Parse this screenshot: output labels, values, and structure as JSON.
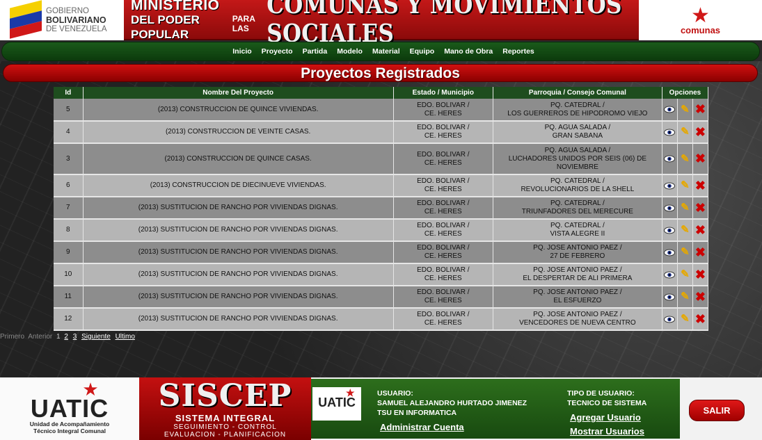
{
  "header": {
    "gov_line1": "GOBIERNO",
    "gov_line2": "BOLIVARIANO",
    "gov_line3": "DE VENEZUELA",
    "ministry_line1": "MINISTERIO",
    "ministry_line2": "DEL PODER POPULAR",
    "ministry_para": "PARA LAS",
    "ministry_big": "COMUNAS Y MOVIMIENTOS SOCIALES",
    "comunas_logo": "comunas"
  },
  "nav": {
    "items": [
      "Inicio",
      "Proyecto",
      "Partida",
      "Modelo",
      "Material",
      "Equipo",
      "Mano de Obra",
      "Reportes"
    ]
  },
  "page_title": "Proyectos Registrados",
  "table": {
    "headers": [
      "Id",
      "Nombre Del Proyecto",
      "Estado / Municipio",
      "Parroquia / Consejo Comunal",
      "Opciones"
    ],
    "rows": [
      {
        "id": "5",
        "name": "(2013) CONSTRUCCION DE QUINCE VIVIENDAS.",
        "estado": "EDO. BOLIVAR /",
        "municipio": "CE. HERES",
        "parroquia": "PQ. CATEDRAL /",
        "consejo": "LOS GUERREROS DE HIPODROMO VIEJO"
      },
      {
        "id": "4",
        "name": "(2013) CONSTRUCCION DE VEINTE CASAS.",
        "estado": "EDO. BOLIVAR /",
        "municipio": "CE. HERES",
        "parroquia": "PQ. AGUA SALADA /",
        "consejo": "GRAN SABANA"
      },
      {
        "id": "3",
        "name": "(2013) CONSTRUCCION DE QUINCE CASAS.",
        "estado": "EDO. BOLIVAR /",
        "municipio": "CE. HERES",
        "parroquia": "PQ. AGUA SALADA /",
        "consejo": "LUCHADORES UNIDOS POR SEIS (06) DE NOVIEMBRE"
      },
      {
        "id": "6",
        "name": "(2013) CONSTRUCCION DE DIECINUEVE VIVIENDAS.",
        "estado": "EDO. BOLIVAR /",
        "municipio": "CE. HERES",
        "parroquia": "PQ. CATEDRAL /",
        "consejo": "REVOLUCIONARIOS DE LA SHELL"
      },
      {
        "id": "7",
        "name": "(2013) SUSTITUCION DE RANCHO POR VIVIENDAS DIGNAS.",
        "estado": "EDO. BOLIVAR /",
        "municipio": "CE. HERES",
        "parroquia": "PQ. CATEDRAL /",
        "consejo": "TRIUNFADORES DEL MERECURE"
      },
      {
        "id": "8",
        "name": "(2013) SUSTITUCION DE RANCHO POR VIVIENDAS DIGNAS.",
        "estado": "EDO. BOLIVAR /",
        "municipio": "CE. HERES",
        "parroquia": "PQ. CATEDRAL /",
        "consejo": "VISTA ALEGRE II"
      },
      {
        "id": "9",
        "name": "(2013) SUSTITUCION DE RANCHO POR VIVIENDAS DIGNAS.",
        "estado": "EDO. BOLIVAR /",
        "municipio": "CE. HERES",
        "parroquia": "PQ. JOSE ANTONIO PAEZ /",
        "consejo": "27 DE FEBRERO"
      },
      {
        "id": "10",
        "name": "(2013) SUSTITUCION DE RANCHO POR VIVIENDAS DIGNAS.",
        "estado": "EDO. BOLIVAR /",
        "municipio": "CE. HERES",
        "parroquia": "PQ. JOSE ANTONIO PAEZ /",
        "consejo": "EL DESPERTAR DE ALI PRIMERA"
      },
      {
        "id": "11",
        "name": "(2013) SUSTITUCION DE RANCHO POR VIVIENDAS DIGNAS.",
        "estado": "EDO. BOLIVAR /",
        "municipio": "CE. HERES",
        "parroquia": "PQ. JOSE ANTONIO PAEZ /",
        "consejo": "EL ESFUERZO"
      },
      {
        "id": "12",
        "name": "(2013) SUSTITUCION DE RANCHO POR VIVIENDAS DIGNAS.",
        "estado": "EDO. BOLIVAR /",
        "municipio": "CE. HERES",
        "parroquia": "PQ. JOSE ANTONIO PAEZ /",
        "consejo": "VENCEDORES DE NUEVA CENTRO"
      }
    ],
    "option_icons": [
      "eye-icon",
      "pencil-icon",
      "delete-x-icon"
    ]
  },
  "pager": {
    "first": "Primero",
    "prev": "Anterior",
    "current": "1",
    "pages": [
      "2",
      "3"
    ],
    "next": "Siguiente",
    "last": "Ultimo"
  },
  "footer": {
    "uatic_name": "UATIC",
    "uatic_sub1": "Unidad de Acompañamiento",
    "uatic_sub2": "Técnico Integral Comunal",
    "siscep_name": "SISCEP",
    "siscep_line1": "SISTEMA INTEGRAL",
    "siscep_line2": "SEGUIMIENTO - CONTROL",
    "siscep_line3": "EVALUACION - PLANIFICACION",
    "mini_logo": "UATIC",
    "usuario_label": "USUARIO:",
    "usuario_name": "SAMUEL ALEJANDRO HURTADO JIMENEZ",
    "usuario_role": "TSU EN INFORMATICA",
    "tipo_label": "TIPO DE USUARIO:",
    "tipo_value": "TECNICO DE SISTEMA",
    "admin_link": "Administrar Cuenta",
    "add_user_link": "Agregar Usuario",
    "show_users_link": "Mostrar Usuarios",
    "logout": "SALIR"
  },
  "colors": {
    "brand_red": "#c41818",
    "brand_green": "#1e4d1e",
    "row_dark": "#8d8d8d",
    "row_light": "#b5b5b5"
  }
}
